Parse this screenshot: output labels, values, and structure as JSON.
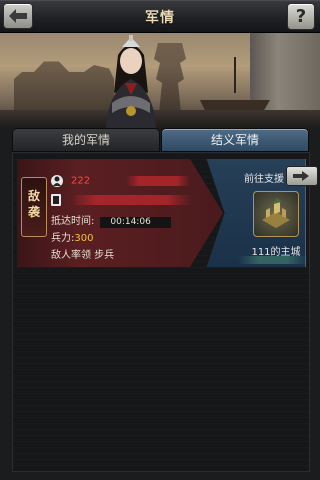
{
  "header": {
    "title": "军情",
    "back_icon": "back-arrow-icon",
    "help_label": "?"
  },
  "tabs": [
    {
      "label": "我的军情",
      "selected": false
    },
    {
      "label": "结义军情",
      "selected": true
    }
  ],
  "report": {
    "badge": "敌袭",
    "player_name": "222",
    "arrive_label": "抵达时间:",
    "arrive_time": "00:14:06",
    "force_label": "兵力:",
    "force_value": "300",
    "lead_text": "敌人率领 步兵",
    "support_label": "前往支援",
    "target_city": "111的主城"
  },
  "colors": {
    "enemy_red": "#ff4840",
    "force_gold": "#f4c33f",
    "ally_tab_blue": "#4f6c86"
  }
}
